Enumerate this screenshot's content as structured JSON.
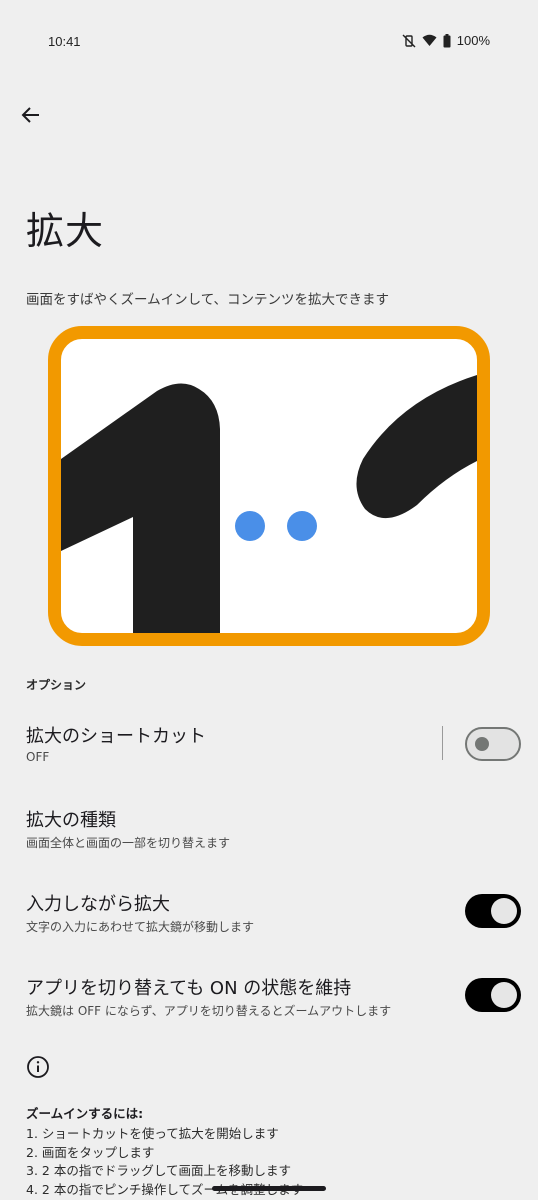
{
  "status_bar": {
    "time": "10:41",
    "battery": "100%",
    "icons": [
      "mute-vibrate-icon",
      "wifi-icon",
      "battery-icon"
    ]
  },
  "header": {
    "back_icon": "arrow-back-icon",
    "title": "拡大",
    "description": "画面をすばやくズームインして、コンテンツを拡大できます"
  },
  "colors": {
    "frame": "#f29900",
    "dots": "#4a8fe8",
    "shape": "#1f1f1f",
    "toggle_on": "#000000"
  },
  "options": {
    "section_label": "オプション",
    "items": [
      {
        "title": "拡大のショートカット",
        "summary": "OFF",
        "toggle": "off"
      },
      {
        "title": "拡大の種類",
        "summary": "画面全体と画面の一部を切り替えます"
      },
      {
        "title": "入力しながら拡大",
        "summary": "文字の入力にあわせて拡大鏡が移動します",
        "toggle": "on"
      },
      {
        "title": "アプリを切り替えても ON の状態を維持",
        "summary": "拡大鏡は OFF にならず、アプリを切り替えるとズームアウトします",
        "toggle": "on"
      }
    ]
  },
  "instructions": {
    "icon": "info-icon",
    "title": "ズームインするには:",
    "lines": [
      "1. ショートカットを使って拡大を開始します",
      "2. 画面をタップします",
      "3. 2 本の指でドラッグして画面上を移動します",
      "4. 2 本の指でピンチ操作してズームを調整します"
    ]
  }
}
